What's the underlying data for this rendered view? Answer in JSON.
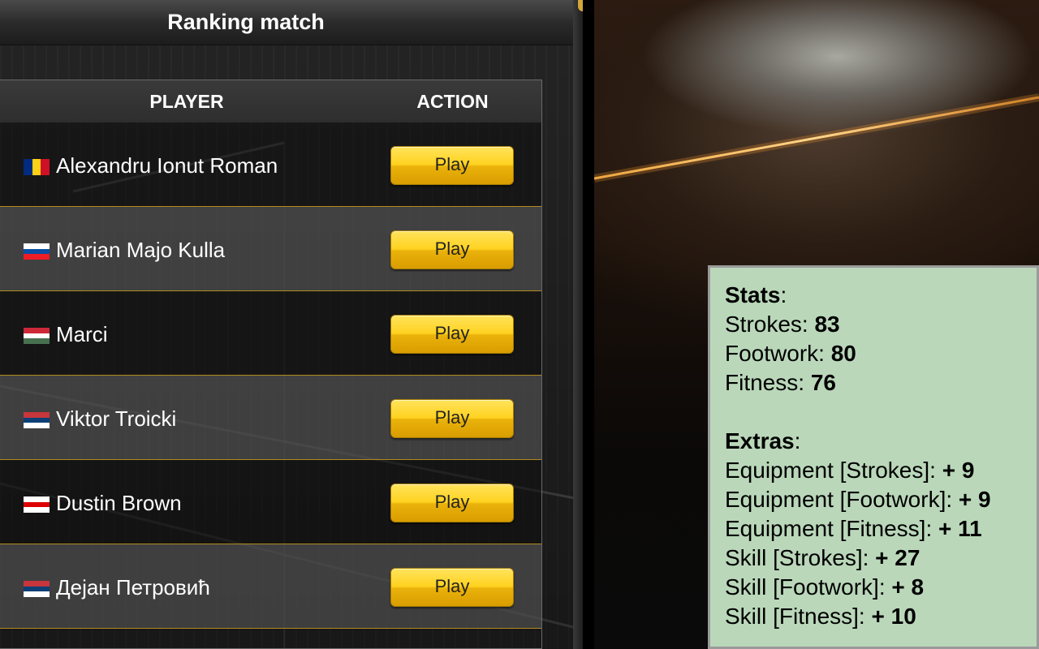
{
  "panel": {
    "title": "Ranking match"
  },
  "table": {
    "headers": {
      "player": "PLAYER",
      "action": "ACTION"
    },
    "rows": [
      {
        "name": "Alexandru Ionut Roman",
        "flag": "romania-flag",
        "flag_colors": [
          "#002b7f",
          "#fcd116",
          "#ce1126"
        ],
        "action": "Play"
      },
      {
        "name": "Marian Majo Kulla",
        "flag": "slovakia-flag",
        "flag_colors": [
          "#ffffff",
          "#0b4ea2",
          "#ee1c25"
        ],
        "action": "Play"
      },
      {
        "name": "Marci",
        "flag": "hungary-flag",
        "flag_colors": [
          "#ce2939",
          "#ffffff",
          "#477050"
        ],
        "action": "Play"
      },
      {
        "name": "Viktor Troicki",
        "flag": "serbia-flag",
        "flag_colors": [
          "#c6363c",
          "#0c4076",
          "#ffffff"
        ],
        "action": "Play"
      },
      {
        "name": "Dustin Brown",
        "flag": "germany-flag",
        "flag_colors": [
          "#ffffff",
          "#dd0000",
          "#ffffff"
        ],
        "action": "Play"
      },
      {
        "name": "Дејан Петровић",
        "flag": "serbia-flag",
        "flag_colors": [
          "#c6363c",
          "#0c4076",
          "#ffffff"
        ],
        "action": "Play"
      }
    ]
  },
  "stats": {
    "heading": "Stats",
    "items": [
      {
        "label": "Strokes: ",
        "value": "83"
      },
      {
        "label": "Footwork: ",
        "value": "80"
      },
      {
        "label": "Fitness: ",
        "value": "76"
      }
    ]
  },
  "extras": {
    "heading": "Extras",
    "items": [
      {
        "label": "Equipment [Strokes]: ",
        "value": "+ 9"
      },
      {
        "label": "Equipment [Footwork]: ",
        "value": "+ 9"
      },
      {
        "label": "Equipment [Fitness]: ",
        "value": "+ 11"
      },
      {
        "label": "Skill [Strokes]: ",
        "value": "+ 27"
      },
      {
        "label": "Skill [Footwork]: ",
        "value": "+ 8"
      },
      {
        "label": "Skill [Fitness]: ",
        "value": "+ 10"
      }
    ]
  },
  "colors": {
    "button_gold": "#ffd21f",
    "stats_background": "#bad7ba",
    "row_separator": "#b08a1e"
  }
}
